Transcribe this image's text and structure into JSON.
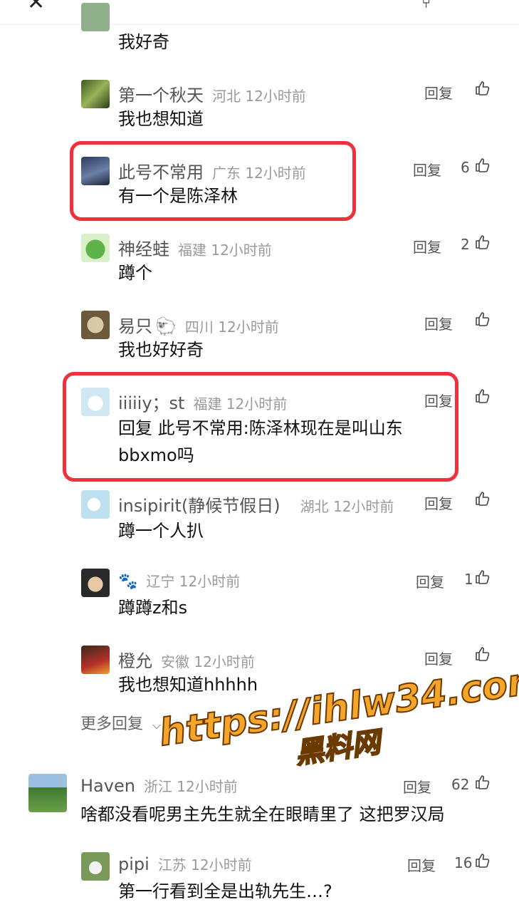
{
  "header": {
    "close_icon": "close-icon",
    "share_icon": "share-icon"
  },
  "reply_label": "回复",
  "more_replies": "更多回复",
  "comments": [
    {
      "text": "我好奇"
    },
    {
      "name": "第一个秋天",
      "region": "河北 12小时前",
      "text": "我也想知道",
      "likes": ""
    },
    {
      "name": "此号不常用",
      "region": "广东 12小时前",
      "text": "有一个是陈泽林",
      "likes": "6"
    },
    {
      "name": "神经蛙",
      "region": "福建 12小时前",
      "text": "蹲个",
      "likes": "2"
    },
    {
      "name": "易只",
      "region": "四川 12小时前",
      "text": "我也好好奇",
      "likes": ""
    },
    {
      "name": "iiiiiy；st",
      "region": "福建 12小时前",
      "text_prefix": "回复",
      "text_target": "此号不常用:",
      "text_line1": "陈泽林现在是叫山东",
      "text_line2": "bbxmo吗",
      "likes": ""
    },
    {
      "name": "insipirit(静候节假日)",
      "region": "湖北 12小时前",
      "text": "蹲一个人扒",
      "likes": ""
    },
    {
      "name": "",
      "region": "辽宁 12小时前",
      "text": "蹲蹲z和s",
      "likes": "1"
    },
    {
      "name": "橙允",
      "region": "安徽 12小时前",
      "text": "我也想知道hhhhh",
      "likes": ""
    },
    {
      "name": "Haven",
      "region": "浙江 12小时前",
      "text": "啥都没看呢男主先生就全在眼睛里了 这把罗汉局",
      "likes": "62"
    },
    {
      "name": "pipi",
      "region": "江苏 12小时前",
      "text": "第一行看到全是出轨先生…?",
      "likes": "16"
    }
  ],
  "watermark": {
    "line1": "https://ihlw34.com",
    "line2": "黑料网"
  },
  "colors": {
    "highlight": "#f0303a",
    "watermark": "#f5a52a"
  }
}
